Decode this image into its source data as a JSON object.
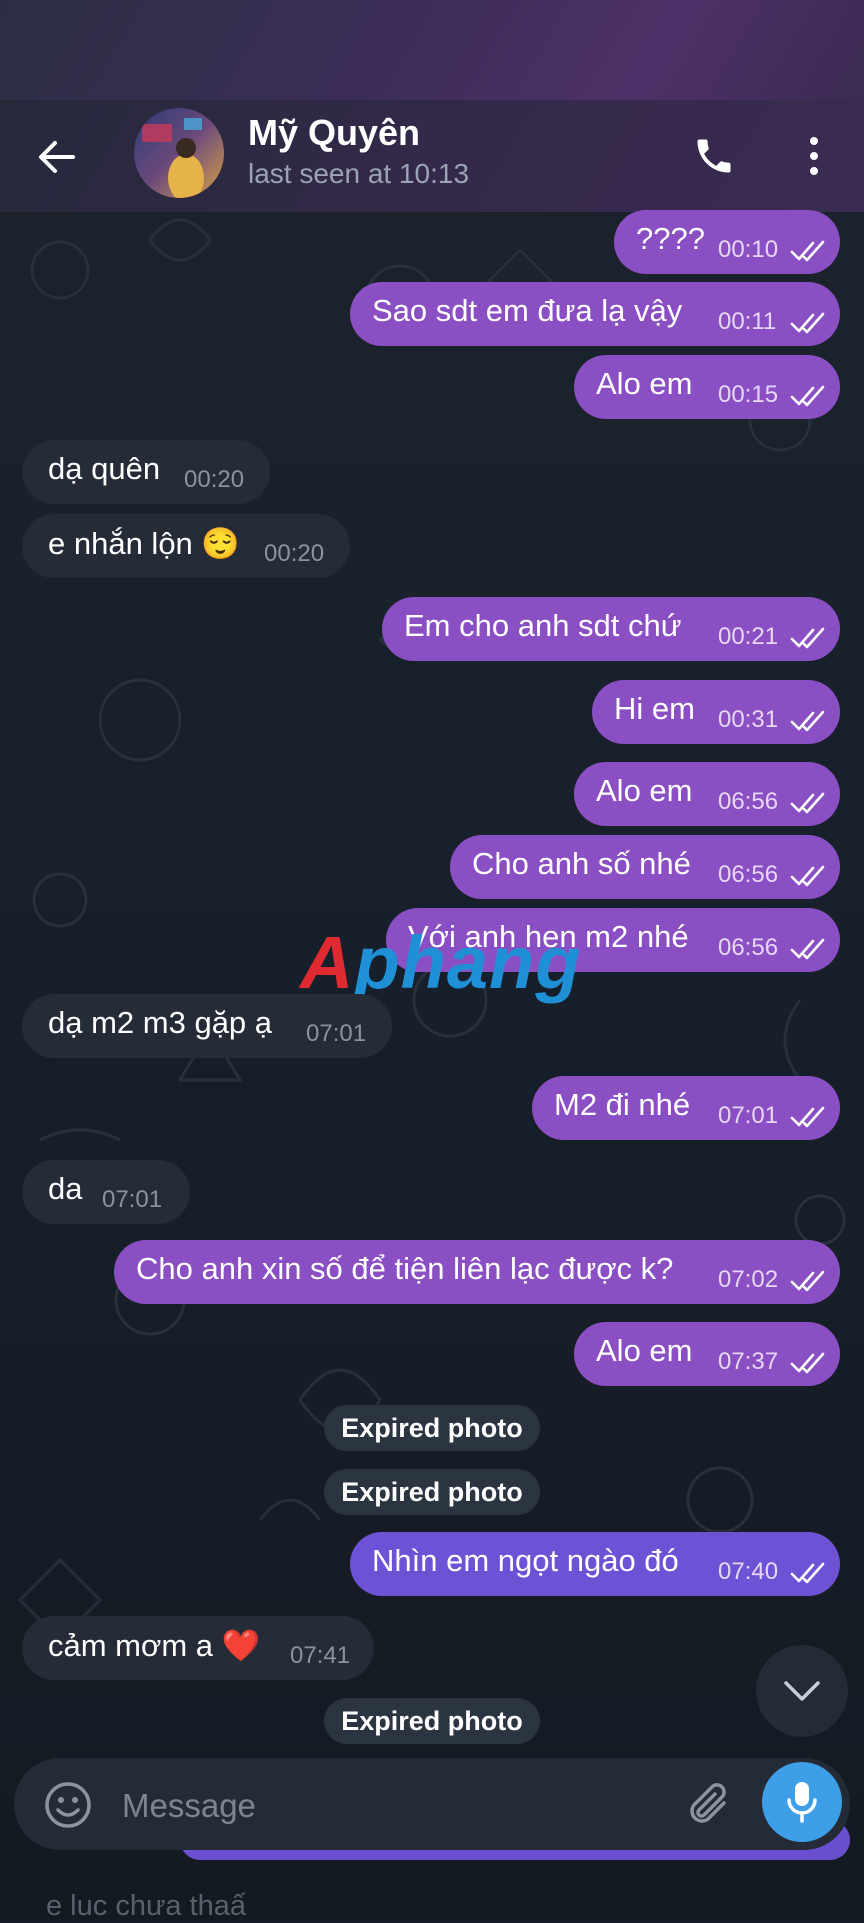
{
  "header": {
    "name": "Mỹ Quyên",
    "status": "last seen at 10:13"
  },
  "messages": [
    {
      "dir": "out",
      "text": "????",
      "time": "00:10"
    },
    {
      "dir": "out",
      "text": "Sao sdt em đưa lạ vậy",
      "time": "00:11"
    },
    {
      "dir": "out",
      "text": "Alo em",
      "time": "00:15"
    },
    {
      "dir": "in",
      "text": "dạ quên",
      "time": "00:20"
    },
    {
      "dir": "in",
      "text": "e nhắn lộn 😌",
      "time": "00:20"
    },
    {
      "dir": "out",
      "text": "Em cho anh sdt chứ",
      "time": "00:21"
    },
    {
      "dir": "out",
      "text": "Hi em",
      "time": "00:31"
    },
    {
      "dir": "out",
      "text": "Alo em",
      "time": "06:56"
    },
    {
      "dir": "out",
      "text": "Cho anh số nhé",
      "time": "06:56"
    },
    {
      "dir": "out",
      "text": "Với anh hẹn m2 nhé",
      "time": "06:56"
    },
    {
      "dir": "in",
      "text": "dạ m2 m3 gặp ạ",
      "time": "07:01"
    },
    {
      "dir": "out",
      "text": "M2 đi nhé",
      "time": "07:01"
    },
    {
      "dir": "in",
      "text": "da",
      "time": "07:01"
    },
    {
      "dir": "out",
      "text": "Cho anh xin số để tiện liên lạc được k?",
      "time": "07:02"
    },
    {
      "dir": "out",
      "text": "Alo em",
      "time": "07:37"
    },
    {
      "dir": "out",
      "text": "Nhìn em ngọt ngào đó",
      "time": "07:40"
    },
    {
      "dir": "in",
      "text": "cảm mơm a ❤️",
      "time": "07:41"
    }
  ],
  "service": {
    "expired_1": "Expired photo",
    "expired_2": "Expired photo",
    "expired_3": "Expired photo"
  },
  "watermark": {
    "first": "A",
    "rest": "phang"
  },
  "input": {
    "placeholder": "Message"
  },
  "peek_text": "e luc chưa thaấ",
  "colors": {
    "outgoing_bubble": "#8b4fc4",
    "incoming_bubble": "#252c37",
    "mic_button": "#3d9fe8"
  },
  "icons": [
    "back-arrow-icon",
    "phone-icon",
    "more-vertical-icon",
    "double-check-icon",
    "chevron-down-icon",
    "emoji-icon",
    "paperclip-icon",
    "microphone-icon"
  ]
}
